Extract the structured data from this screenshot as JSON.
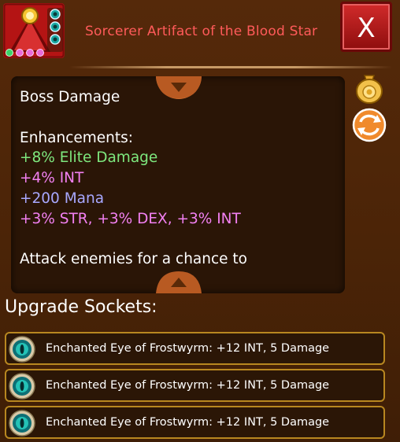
{
  "header": {
    "title": "Sorcerer Artifact of the Blood Star",
    "close_label": "X"
  },
  "description": {
    "lines": [
      {
        "text": "Boss Damage",
        "color": "#ffffff"
      },
      {
        "text": "",
        "color": "#ffffff"
      },
      {
        "text": "Enhancements:",
        "color": "#ffffff"
      },
      {
        "text": "+8% Elite Damage",
        "color": "#7ee87e"
      },
      {
        "text": "+4% INT",
        "color": "#f280f2"
      },
      {
        "text": "+200 Mana",
        "color": "#a8a8ff"
      },
      {
        "text": "+3% STR, +3% DEX, +3% INT",
        "color": "#f280f2"
      },
      {
        "text": "",
        "color": "#ffffff"
      },
      {
        "text": "Attack enemies for a chance to",
        "color": "#ffffff"
      }
    ]
  },
  "sockets": {
    "header": "Upgrade Sockets:",
    "items": [
      {
        "text": "Enchanted Eye of Frostwyrm: +12 INT, 5 Damage"
      },
      {
        "text": "Enchanted Eye of Frostwyrm: +12 INT, 5 Damage"
      },
      {
        "text": "Enchanted Eye of Frostwyrm: +12 INT, 5 Damage"
      }
    ]
  },
  "icons": {
    "item": "sorcerer-artifact-icon",
    "gold": "gold-bag-icon",
    "swap": "swap-arrows-icon",
    "socket_gem": "frostwyrm-eye-gem-icon"
  }
}
